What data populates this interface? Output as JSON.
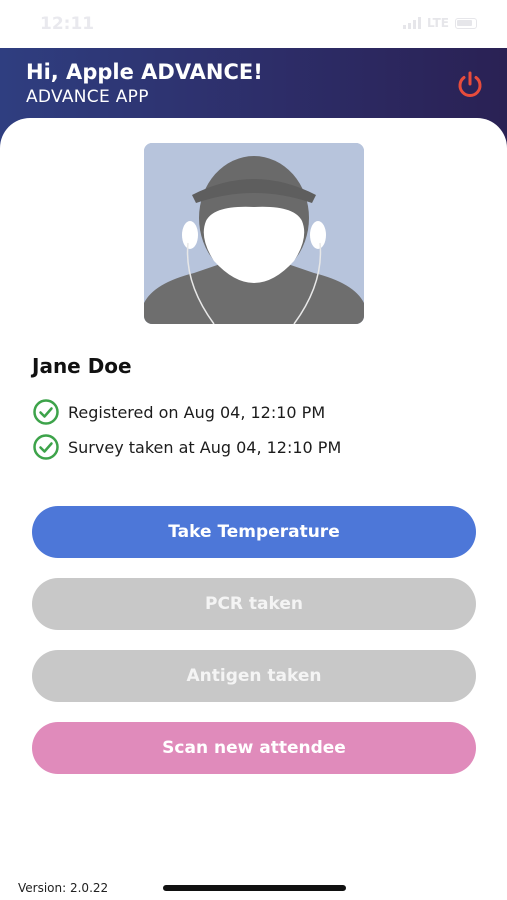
{
  "status_bar": {
    "time": "12:11",
    "network": "LTE"
  },
  "header": {
    "greeting": "Hi, Apple ADVANCE!",
    "subtitle": "ADVANCE APP",
    "power_icon": "power-icon",
    "power_color": "#e74c3c"
  },
  "attendee": {
    "name": "Jane Doe",
    "avatar_icon": "person-silhouette",
    "statuses": [
      {
        "text": "Registered on Aug 04, 12:10 PM",
        "icon": "check-circle-icon"
      },
      {
        "text": "Survey taken at Aug 04, 12:10 PM",
        "icon": "check-circle-icon"
      }
    ]
  },
  "actions": {
    "take_temperature": "Take Temperature",
    "pcr_taken": "PCR taken",
    "antigen_taken": "Antigen taken",
    "scan_new_attendee": "Scan new attendee"
  },
  "colors": {
    "primary": "#4d77d8",
    "disabled": "#c8c8c8",
    "accent_pink": "#e08bbb",
    "success": "#3da34a",
    "header_start": "#2f3e80",
    "header_end": "#2a2154"
  },
  "footer": {
    "version": "Version: 2.0.22"
  }
}
